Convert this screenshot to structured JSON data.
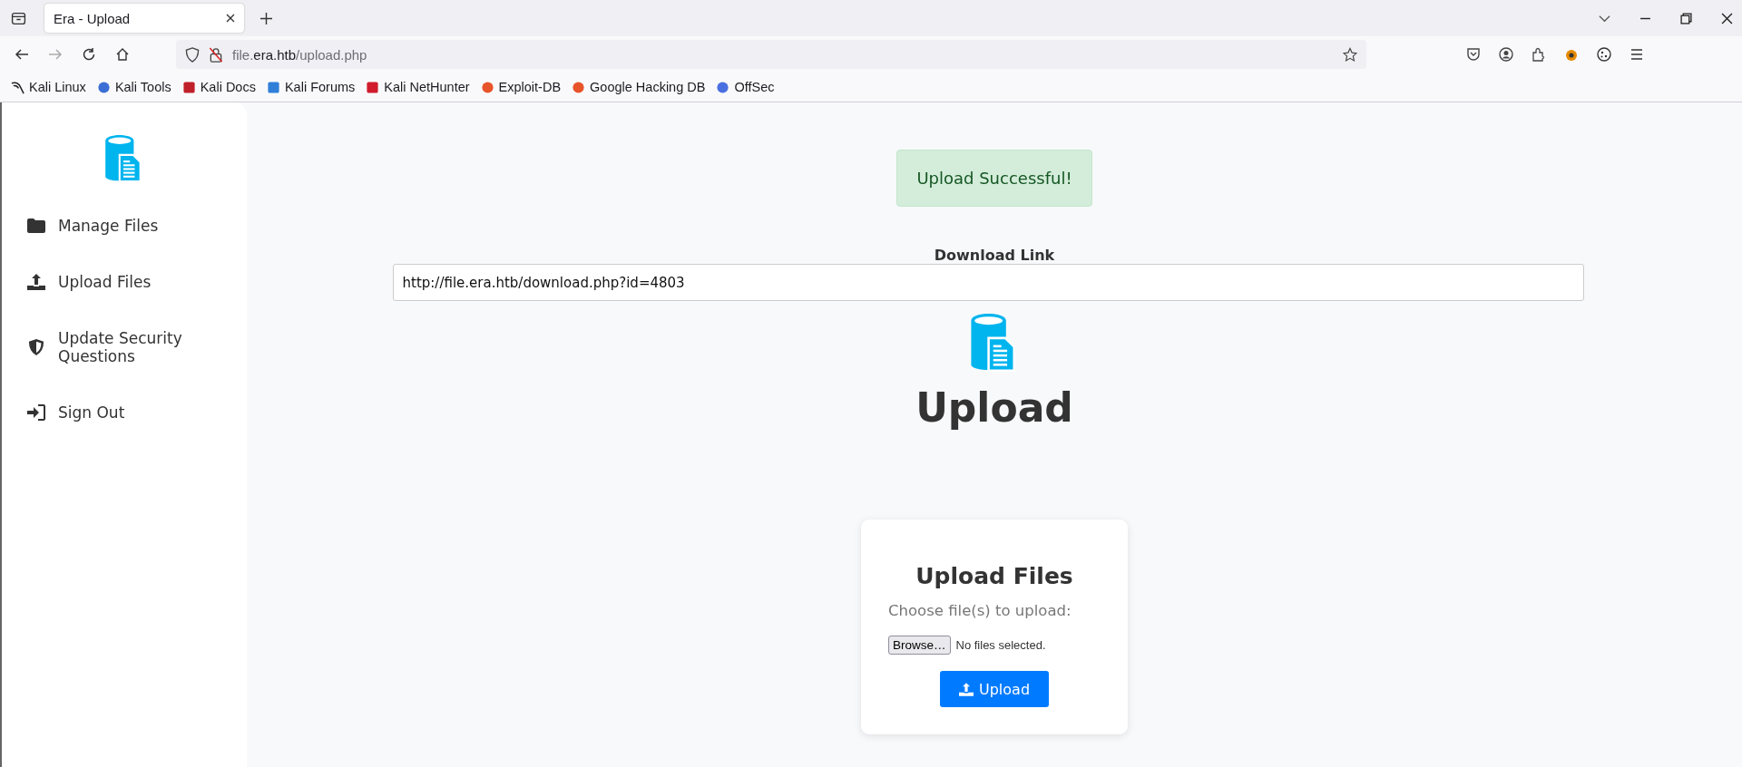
{
  "browser": {
    "tabs": [
      {
        "title": "Era - Upload",
        "selected": true
      }
    ],
    "url": {
      "subdomain": "file.",
      "domain": "era.htb",
      "path": "/upload.php"
    },
    "bookmarks": [
      {
        "label": "Kali Linux"
      },
      {
        "label": "Kali Tools"
      },
      {
        "label": "Kali Docs"
      },
      {
        "label": "Kali Forums"
      },
      {
        "label": "Kali NetHunter"
      },
      {
        "label": "Exploit-DB"
      },
      {
        "label": "Google Hacking DB"
      },
      {
        "label": "OffSec"
      }
    ]
  },
  "sidebar": {
    "items": [
      {
        "label": "Manage Files",
        "kind": "folder"
      },
      {
        "label": "Upload Files",
        "kind": "upload"
      },
      {
        "label": "Update Security Questions",
        "kind": "shield"
      },
      {
        "label": "Sign Out",
        "kind": "signout"
      }
    ]
  },
  "alert": {
    "text": "Upload Successful!"
  },
  "download": {
    "label": "Download Link",
    "value": "http://file.era.htb/download.php?id=4803"
  },
  "heading": "Upload",
  "card": {
    "title": "Upload Files",
    "prompt": "Choose file(s) to upload:",
    "browse_button": "Browse…",
    "file_status": "No files selected.",
    "submit_button": "Upload"
  }
}
